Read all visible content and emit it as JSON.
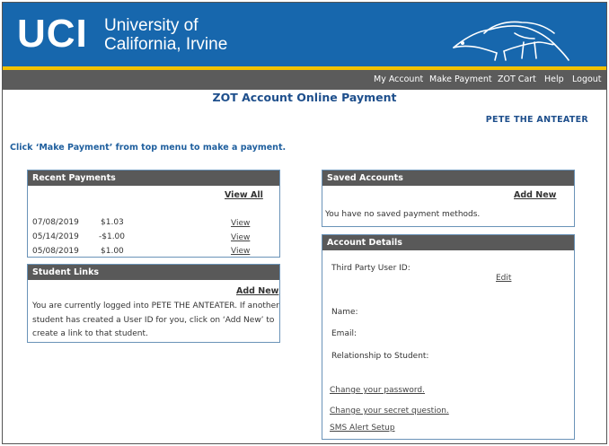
{
  "header": {
    "logo_text": "UCI",
    "university_line1": "University of",
    "university_line2": "California, Irvine",
    "mascot_icon": "anteater-icon"
  },
  "colors": {
    "banner_blue": "#1767ad",
    "gold_stripe": "#f2c200",
    "nav_gray": "#5b5b5b",
    "title_blue": "#1e4f8c",
    "panel_border": "#6a93b8"
  },
  "nav": {
    "items": [
      "My Account",
      "Make Payment",
      "ZOT Cart",
      "Help",
      "Logout"
    ]
  },
  "page": {
    "title": "ZOT Account Online Payment",
    "user_name": "PETE THE ANTEATER",
    "instruction": "Click ‘Make Payment’ from top menu to make a payment."
  },
  "recent_payments": {
    "title": "Recent Payments",
    "view_all": "View All",
    "rows": [
      {
        "date": "07/08/2019",
        "amount": "$1.03",
        "action": "View"
      },
      {
        "date": "05/14/2019",
        "amount": "-$1.00",
        "action": "View"
      },
      {
        "date": "05/08/2019",
        "amount": "$1.00",
        "action": "View"
      }
    ]
  },
  "student_links": {
    "title": "Student Links",
    "add_new": "Add New",
    "text": "You are currently logged into PETE THE ANTEATER. If another student has created a User ID for you, click on ‘Add New’ to create a link to that student."
  },
  "saved_accounts": {
    "title": "Saved Accounts",
    "add_new": "Add New",
    "empty_text": "You have no saved payment methods."
  },
  "account_details": {
    "title": "Account Details",
    "third_party_label": "Third Party User ID:",
    "edit": "Edit",
    "name_label": "Name:",
    "email_label": "Email:",
    "relationship_label": "Relationship to Student:",
    "change_password": "Change your password.",
    "change_question": "Change your secret question.",
    "sms_setup": "SMS Alert Setup"
  }
}
